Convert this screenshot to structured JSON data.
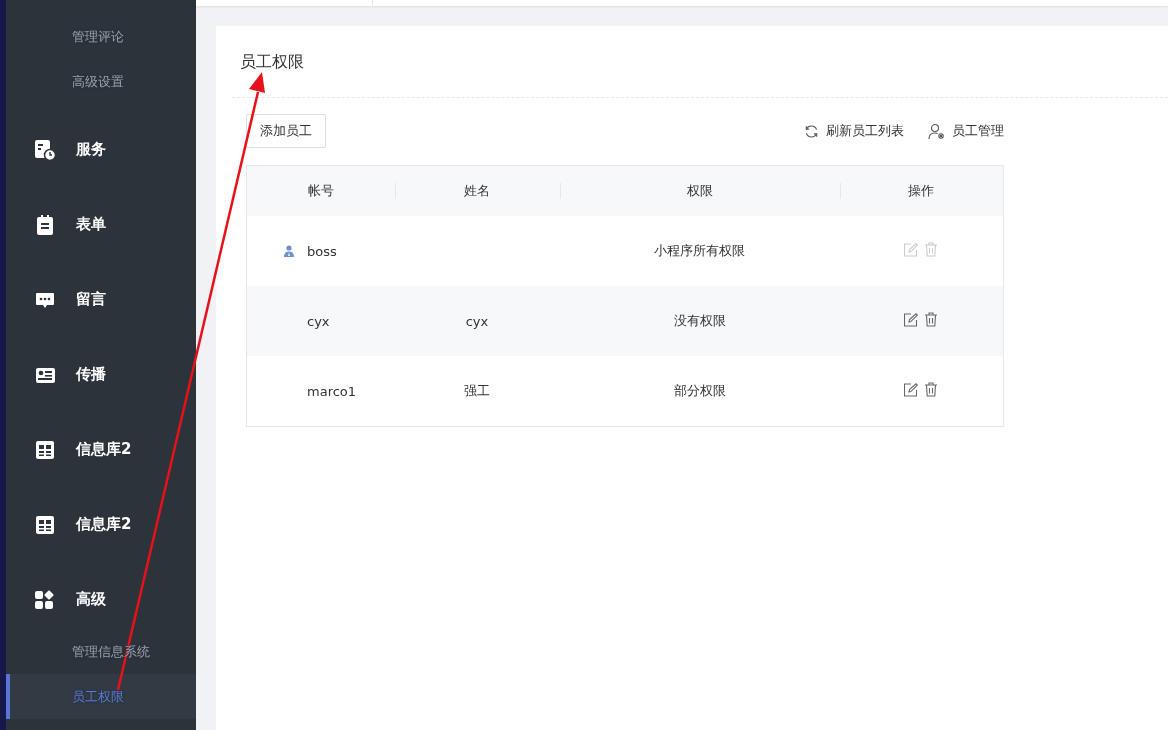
{
  "sidebar": {
    "items": [
      {
        "kind": "sub",
        "label": "管理评论",
        "selected": false
      },
      {
        "kind": "sub",
        "label": "高级设置",
        "selected": false
      },
      {
        "kind": "group",
        "label": "服务"
      },
      {
        "kind": "group",
        "label": "表单"
      },
      {
        "kind": "group",
        "label": "留言"
      },
      {
        "kind": "group",
        "label": "传播"
      },
      {
        "kind": "group",
        "label": "信息库2"
      },
      {
        "kind": "group",
        "label": "信息库2"
      },
      {
        "kind": "group",
        "label": "高级"
      },
      {
        "kind": "sub",
        "label": "管理信息系统",
        "selected": false
      },
      {
        "kind": "sub",
        "label": "员工权限",
        "selected": true
      }
    ]
  },
  "panel": {
    "title": "员工权限",
    "add_button": "添加员工",
    "refresh_link": "刷新员工列表",
    "manage_link": "员工管理",
    "table": {
      "columns": [
        "帐号",
        "姓名",
        "权限",
        "操作"
      ],
      "rows": [
        {
          "account": "boss",
          "name": "",
          "permission": "小程序所有权限",
          "is_owner": true,
          "actions_disabled": true
        },
        {
          "account": "cyx",
          "name": "cyx",
          "permission": "没有权限",
          "is_owner": false,
          "actions_disabled": false
        },
        {
          "account": "marco1",
          "name": "强工",
          "permission": "部分权限",
          "is_owner": false,
          "actions_disabled": false
        }
      ]
    }
  }
}
